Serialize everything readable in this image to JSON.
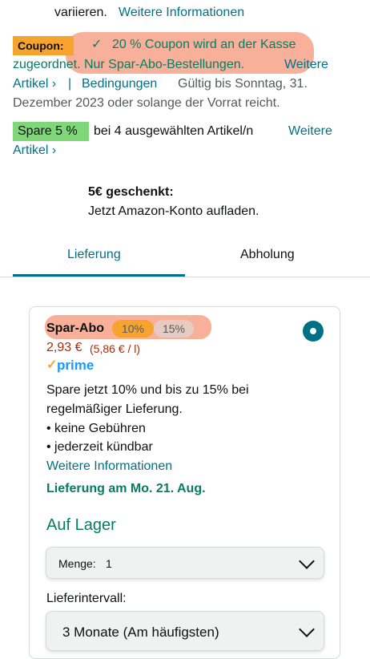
{
  "top": {
    "line1_text": "variieren.",
    "line1_link": "Weitere Informationen"
  },
  "coupon": {
    "badge": "Coupon:",
    "check_glyph": "✓",
    "line1": "20 % Coupon wird an der Kasse",
    "line2": "zugeordnet. Nur Spar-Abo-Bestellungen.",
    "more_link": "Weitere",
    "articles_link": "Artikel ›",
    "separator": "|",
    "conditions_link": "Bedingungen",
    "validity_part1": "Gültig bis Sonntag, 31.",
    "validity_part2": "Dezember 2023 oder solange der Vorrat reicht."
  },
  "spare": {
    "badge": "Spare 5 %",
    "text": "bei 4 ausgewählten Artikel/n",
    "more_link": "Weitere",
    "articles_link": "Artikel ›"
  },
  "gift": {
    "title": "5€ geschenkt:",
    "text": "Jetzt Amazon-Konto aufladen."
  },
  "tabs": [
    {
      "label": "Lieferung",
      "active": true
    },
    {
      "label": "Abholung",
      "active": false
    }
  ],
  "offer": {
    "title": "Spar-Abo",
    "pill_1": "10%",
    "pill_2": "15%",
    "price": "2,93 €",
    "unit_price": "(5,86 € / l)",
    "prime_check": "✓",
    "prime_label": "prime",
    "desc_line1": "Spare jetzt 10% und bis zu 15% bei",
    "desc_line2": "regelmäßiger Lieferung.",
    "bullet_1": "• keine Gebühren",
    "bullet_2": "• jederzeit kündbar",
    "info_link": "Weitere Informationen",
    "delivery": "Lieferung am Mo. 21. Aug.",
    "stock": "Auf Lager",
    "quantity_label": "Menge:",
    "quantity_value": "1",
    "interval_label": "Lieferintervall:",
    "interval_value": "3 Monate (Am häufigsten)"
  },
  "colors": {
    "link": "#007185",
    "coupon_badge": "#f7a32f",
    "spare_badge": "#7fd779",
    "green_text": "#067d62",
    "price": "#b12704",
    "highlight": "#f59678"
  }
}
